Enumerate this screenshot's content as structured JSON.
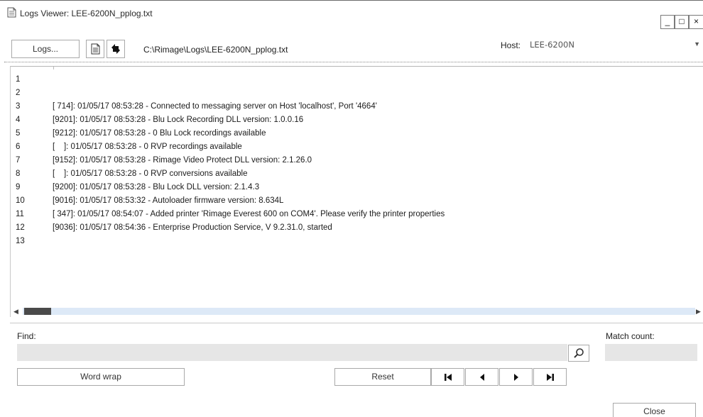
{
  "window": {
    "title": "Logs Viewer: LEE-6200N_pplog.txt",
    "controls": {
      "minimize": "_",
      "maximize": "□",
      "close": "×"
    }
  },
  "toolbar": {
    "logs_label": "Logs...",
    "path": "C:\\Rimage\\Logs\\LEE-6200N_pplog.txt",
    "host_label": "Host:",
    "host_value": "LEE-6200N",
    "icons": [
      "document-icon",
      "swap-arrows-icon",
      "chevron-down-icon"
    ]
  },
  "log": {
    "lines": [
      {
        "n": "1",
        "text": ""
      },
      {
        "n": "2",
        "text": ""
      },
      {
        "n": "3",
        "text": "[ 714]: 01/05/17 08:53:28 - Connected to messaging server on Host 'localhost', Port '4664'"
      },
      {
        "n": "4",
        "text": "[9201]: 01/05/17 08:53:28 - Blu Lock Recording DLL version: 1.0.0.16"
      },
      {
        "n": "5",
        "text": "[9212]: 01/05/17 08:53:28 - 0 Blu Lock recordings available"
      },
      {
        "n": "6",
        "text": "[    ]: 01/05/17 08:53:28 - 0 RVP recordings available"
      },
      {
        "n": "7",
        "text": "[9152]: 01/05/17 08:53:28 - Rimage Video Protect DLL version: 2.1.26.0"
      },
      {
        "n": "8",
        "text": "[    ]: 01/05/17 08:53:28 - 0 RVP conversions available"
      },
      {
        "n": "9",
        "text": "[9200]: 01/05/17 08:53:28 - Blu Lock DLL version: 2.1.4.3"
      },
      {
        "n": "10",
        "text": "[9016]: 01/05/17 08:53:32 - Autoloader firmware version: 8.634L"
      },
      {
        "n": "11",
        "text": "[ 347]: 01/05/17 08:54:07 - Added printer 'Rimage Everest 600 on COM4'. Please verify the printer properties"
      },
      {
        "n": "12",
        "text": "[9036]: 01/05/17 08:54:36 - Enterprise Production Service, V 9.2.31.0, started"
      },
      {
        "n": "13",
        "text": ""
      }
    ],
    "scroll_arrows": {
      "left": "◀",
      "right": "▶"
    }
  },
  "find": {
    "label": "Find:",
    "value": "",
    "match_label": "Match count:",
    "match_value": "",
    "word_wrap_label": "Word wrap",
    "reset_label": "Reset",
    "nav_icons": [
      "first-icon",
      "previous-icon",
      "next-icon",
      "last-icon"
    ],
    "search_icon": "magnifier-icon"
  },
  "footer": {
    "close_label": "Close"
  }
}
